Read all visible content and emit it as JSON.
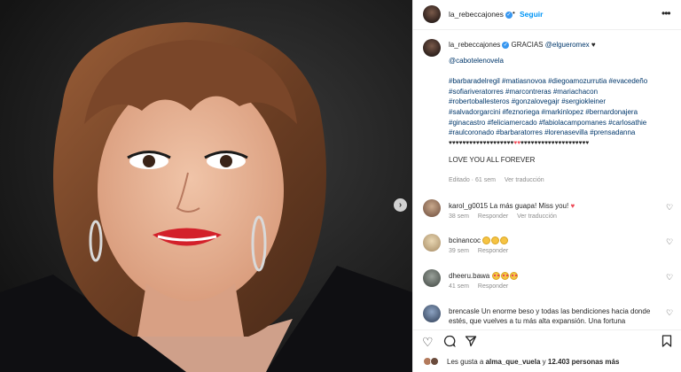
{
  "post": {
    "username": "la_rebeccajones",
    "follow_label": "Seguir",
    "more_label": "•••"
  },
  "caption": {
    "username": "la_rebeccajones",
    "intro": "GRACIAS",
    "mention1": "@elgueromex",
    "mention2": "@cabotelenovela",
    "tags_line1": "#barbaradelregil #matiasnovoa #diegoamozurrutia #evacedeño",
    "tags_line2": "#sofiariveratorres #marcontreras #mariachacon",
    "tags_line3": "#robertoballesteros #gonzalovegajr #sergiokleiner",
    "tags_line4": "#salvadorgarcini #feznoriega #markinlopez #bernardonajera",
    "tags_line5": "#ginacastro #feliciamercado #fabiolacampomanes #carlosathie",
    "tags_line6": "#raulcoronado #barbaratorres #lorenasevilla #prensadanna",
    "hearts_black_a": "♥♥♥♥♥♥♥♥♥♥♥♥♥♥♥♥♥♥♥",
    "hearts_red": "♥♥",
    "hearts_black_b": "♥♥♥♥♥♥♥♥♥♥♥♥♥♥♥♥♥♥♥♥",
    "closing": "LOVE YOU ALL FOREVER",
    "edited": "Editado · 61 sem",
    "see_translation": "Ver traducción"
  },
  "comments": [
    {
      "user": "karol_g0015",
      "text": "La más guapa! Miss you! ",
      "time": "38 sem",
      "reply": "Responder",
      "translate": "Ver traducción"
    },
    {
      "user": "bcinancoc",
      "text": "",
      "time": "39 sem",
      "reply": "Responder"
    },
    {
      "user": "dheeru.bawa",
      "text": "",
      "time": "41 sem",
      "reply": "Responder"
    },
    {
      "user": "brencasle",
      "text": "Un enorme beso y todas las bendiciones hacia donde estés, que vuelves a tu más alta expansión. Una fortuna"
    }
  ],
  "likes": {
    "prefix": "Les gusta a",
    "user": "alma_que_vuela",
    "middle": "y",
    "count": "12.403 personas más"
  },
  "colors": {
    "link": "#00376b",
    "follow": "#0095f6",
    "heart": "#ed4956"
  }
}
